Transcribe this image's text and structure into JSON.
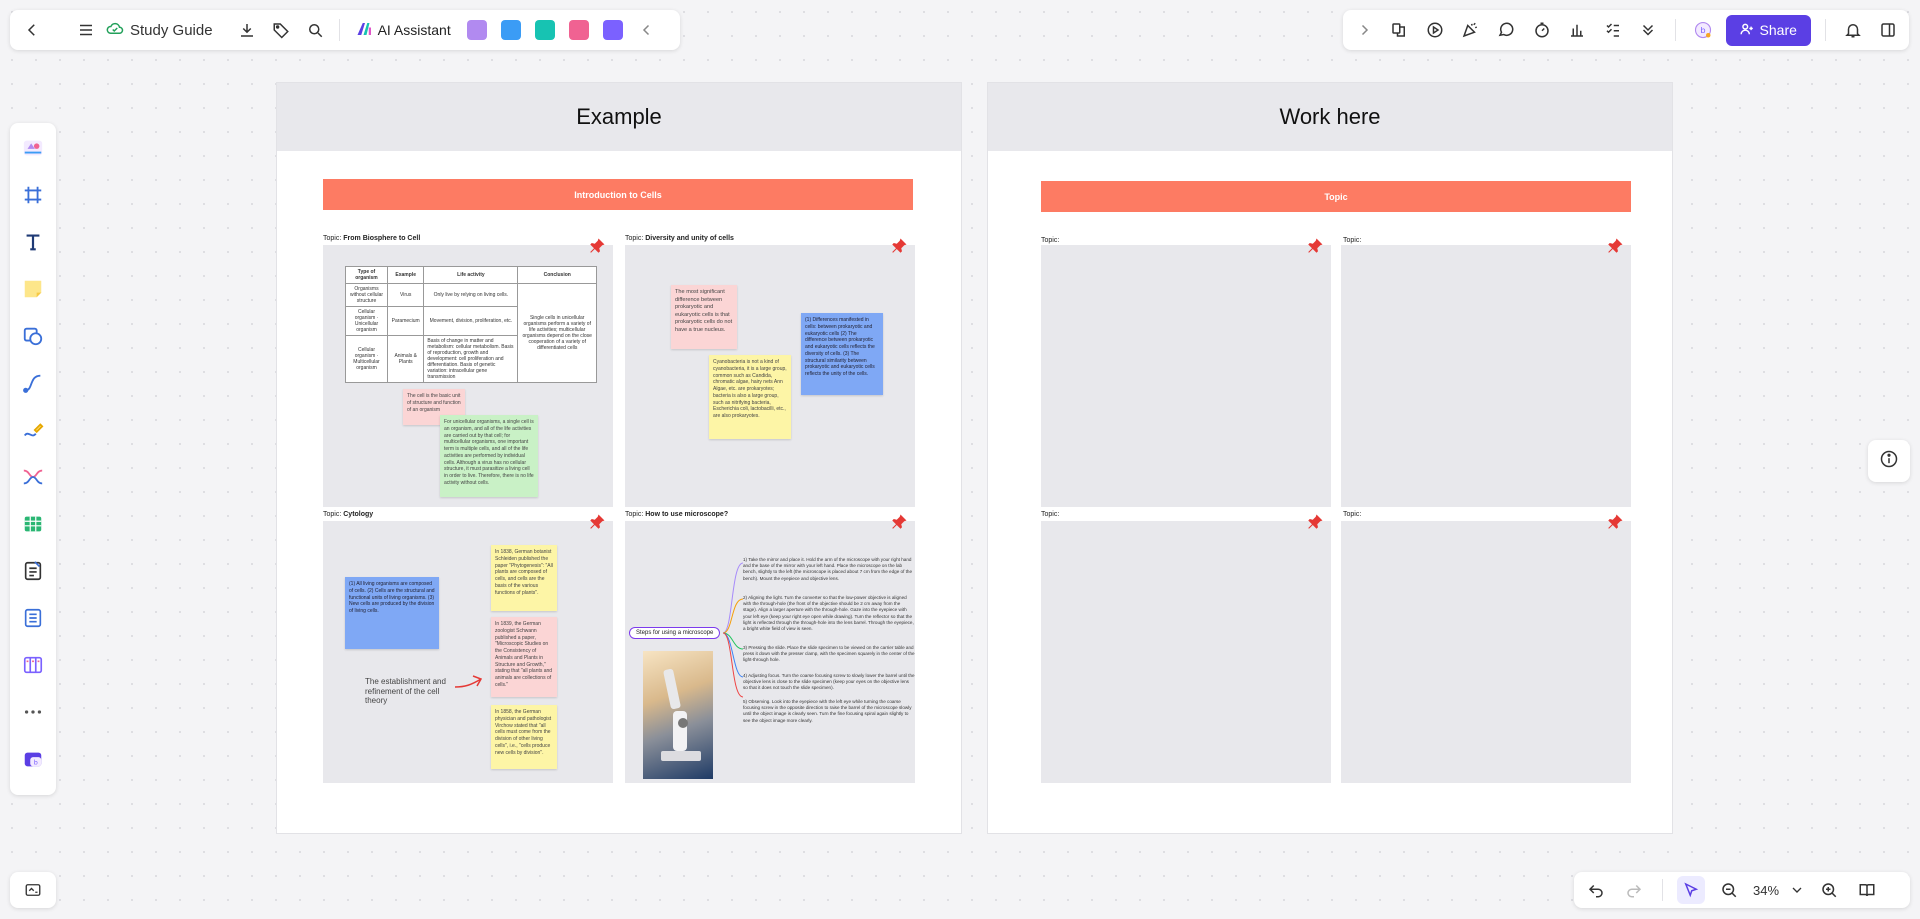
{
  "toolbar": {
    "doc_title": "Study Guide",
    "ai_label": "AI Assistant",
    "app_colors": [
      "#b18af0",
      "#3b9cf5",
      "#17c3b2",
      "#f06292",
      "#7b61ff"
    ],
    "share_label": "Share",
    "accent": "#5b3fe4"
  },
  "zoom": {
    "level": "34%"
  },
  "frames": [
    {
      "title": "Example",
      "banner": "Introduction to Cells",
      "panels": [
        {
          "label": "Topic:",
          "topic": "From Biosphere to Cell",
          "table": {
            "headers": [
              "Type of organism",
              "Example",
              "Life activity",
              "Conclusion"
            ],
            "rows": [
              [
                "Organisms without cellular structure",
                "Virus",
                "Only live by relying on living cells.",
                "Single cells in unicellular organisms perform a variety of life activities; multicellular organisms depend on the close cooperation of a variety of differentiated cells"
              ],
              [
                "Cellular organism · Unicellular organism",
                "Paramecium",
                "Movement, division, proliferation, etc.",
                ""
              ],
              [
                "Cellular organism · Multicellular organism",
                "Animals & Plants",
                "Basis of change in matter and metabolism: cellular metabolism. Basis of reproduction, growth and development: cell proliferation and differentiation. Basis of genetic variation: intracellular gene transmission",
                ""
              ]
            ]
          },
          "notes": [
            "The cell is the basic unit of structure and function of an organism",
            "For unicellular organisms, a single cell is an organism, and all of the life activities are carried out by that cell; for multicellular organisms, one important term is multiple cells, and all of the life activities are performed by individual cells. Although a virus has no cellular structure, it must parasitize a living cell in order to live. Therefore, there is no life activity without cells."
          ]
        },
        {
          "label": "Topic:",
          "topic": "Diversity and unity of cells",
          "notes": [
            "The most significant difference between prokaryotic and eukaryotic cells is that prokaryotic cells do not have a true nucleus.",
            "Cyanobacteria is not a kind of cyanobacteria, it is a large group, common such as Candida, chromatic algae, hairy nets Ann Algae, etc. are prokaryotes; bacteria is also a large group, such as nitrifying bacteria, Escherichia coli, lactobacilli, etc., are also prokaryotes.",
            "(1) Differences manifested in cells: between prokaryotic and eukaryotic cells (2) The difference between prokaryotic and eukaryotic cells reflects the diversity of cells. (3) The structural similarity between prokaryotic and eukaryotic cells reflects the unity of the cells."
          ]
        },
        {
          "label": "Topic:",
          "topic": "Cytology",
          "notes": [
            "(1) All living organisms are composed of cells. (2) Cells are the structural and functional units of living organisms. (3) New cells are produced by the division of living cells.",
            "In 1838, German botanist Schleiden published the paper \"Phytogenesis\": \"All plants are composed of cells, and cells are the basis of the various functions of plants\".",
            "In 1839, the German zoologist Schwann published a paper, \"Microscopic Studies on the Consistency of Animals and Plants in Structure and Growth,\" stating that \"all plants and animals are collections of cells.\"",
            "In 1858, the German physician and pathologist Virchow stated that \"all cells must come from the division of other living cells\", i.e., \"cells produce new cells by division\"."
          ],
          "caption": "The establishment and refinement of the cell theory"
        },
        {
          "label": "Topic:",
          "topic": "How to use microscope?",
          "root": "Steps for using a microscope",
          "steps": [
            "1) Take the mirror and place it. Hold the arm of the microscope with your right hand and the base of the mirror with your left hand. Place the microscope on the lab bench, slightly to the left (the microscope is placed about 7 cm from the edge of the bench). Mount the eyepiece and objective lens.",
            "2) Aligning the light. Turn the converter so that the low-power objective is aligned with the through-hole (the front of the objective should be 2 cm away from the stage). Align a larger aperture with the through-hole. Gaze into the eyepiece with your left eye (keep your right eye open while drawing). Turn the reflector so that the light is reflected through the through-hole into the lens barrel. Through the eyepiece, a bright white field of view is seen.",
            "3) Pressing the slide. Place the slide specimen to be viewed on the carrier table and press it down with the presser clamp, with the specimen squarely in the center of the light-through hole.",
            "4) Adjusting focus. Turn the coarse focusing screw to slowly lower the barrel until the objective lens is close to the slide specimen (keep your eyes on the objective lens so that it does not touch the slide specimen).",
            "5) Observing. Look into the eyepiece with the left eye while turning the coarse focusing screw in the opposite direction to raise the barrel of the microscope slowly until the object image is clearly seen. Turn the fine focusing spiral again slightly to see the object image more clearly."
          ]
        }
      ]
    },
    {
      "title": "Work here",
      "banner": "Topic",
      "panels": [
        {
          "label": "Topic:"
        },
        {
          "label": "Topic:"
        },
        {
          "label": "Topic:"
        },
        {
          "label": "Topic:"
        }
      ]
    }
  ]
}
